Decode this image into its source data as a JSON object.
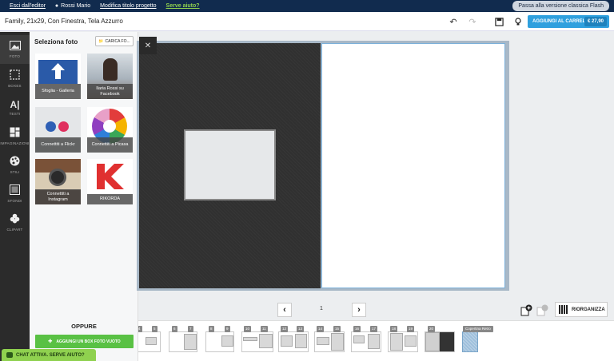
{
  "topbar": {
    "exit_editor": "Esci dall'editor",
    "user_name": "Rossi Mario",
    "edit_title": "Modifica titolo progetto",
    "help": "Serve aiuto?",
    "flash": "Passa alla versione classica Flash"
  },
  "titlebar": {
    "project_title": "Family, 21x29, Con Finestra, Tela Azzurro",
    "add_to_cart": "AGGIUNGI AL CARRELLO",
    "price": "€ 27,90"
  },
  "rail": {
    "items": [
      {
        "label": "FOTO",
        "icon": "image-icon"
      },
      {
        "label": "BOXES",
        "icon": "box-icon"
      },
      {
        "label": "TESTI",
        "icon": "text-icon"
      },
      {
        "label": "IMPAGINAZIONI",
        "icon": "layout-icon"
      },
      {
        "label": "STILI",
        "icon": "palette-icon"
      },
      {
        "label": "SFONDI",
        "icon": "background-icon"
      },
      {
        "label": "CLIPART",
        "icon": "clipart-icon"
      }
    ]
  },
  "panel": {
    "title": "Seleziona foto",
    "upload": "CARICA FO...",
    "sources": [
      {
        "label": "Sfoglia - Galleria"
      },
      {
        "label": "Ilaria Rossi su Facebook"
      },
      {
        "label": "Connettiti a Flickr"
      },
      {
        "label": "Connettiti a Picasa"
      },
      {
        "label": "Connettiti a Instagram"
      },
      {
        "label": "RIKORDA"
      }
    ],
    "or": "OPPURE",
    "add_box": "AGGIUNGI UN BOX FOTO VUOTO"
  },
  "chat": "CHAT ATTIVA. SERVE AIUTO?",
  "navigation": {
    "page": "1"
  },
  "actions": {
    "reorganize": "RIORGANIZZA"
  },
  "filmstrip": {
    "page_numbers": [
      "4",
      "5",
      "6",
      "7",
      "8",
      "9",
      "10",
      "11",
      "12",
      "13",
      "14",
      "15",
      "16",
      "17",
      "18",
      "19",
      "20"
    ],
    "cover_back": "Copertina Retro"
  },
  "colors": {
    "topbar": "#112b4e",
    "cart": "#2fa0de",
    "green": "#59c144",
    "chat": "#8fd14f",
    "rail": "#2b2b2b"
  }
}
